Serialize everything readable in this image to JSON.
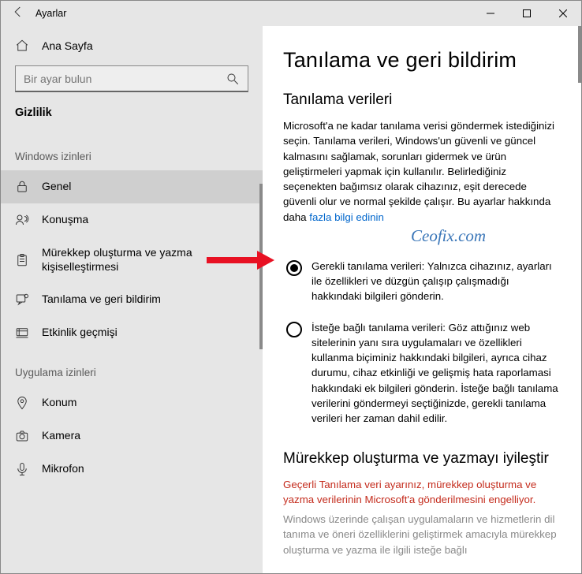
{
  "titlebar": {
    "title": "Ayarlar"
  },
  "sidebar": {
    "home_label": "Ana Sayfa",
    "search_placeholder": "Bir ayar bulun",
    "category": "Gizlilik",
    "section1": "Windows izinleri",
    "section2": "Uygulama izinleri",
    "items": [
      {
        "label": "Genel"
      },
      {
        "label": "Konuşma"
      },
      {
        "label": "Mürekkep oluşturma ve yazma kişiselleştirmesi"
      },
      {
        "label": "Tanılama ve geri bildirim"
      },
      {
        "label": "Etkinlik geçmişi"
      }
    ],
    "app_items": [
      {
        "label": "Konum"
      },
      {
        "label": "Kamera"
      },
      {
        "label": "Mikrofon"
      }
    ]
  },
  "main": {
    "title": "Tanılama ve geri bildirim",
    "section1_title": "Tanılama verileri",
    "section1_desc": "Microsoft'a ne kadar tanılama verisi göndermek istediğinizi seçin. Tanılama verileri, Windows'un güvenli ve güncel kalmasını sağlamak, sorunları gidermek ve ürün geliştirmeleri yapmak için kullanılır. Belirlediğiniz seçenekten bağımsız olarak cihazınız, eşit derecede güvenli olur ve normal şekilde çalışır. Bu ayarlar hakkında daha ",
    "section1_link": "fazla bilgi edinin",
    "watermark": "Ceofix.com",
    "radio1": "Gerekli tanılama verileri: Yalnızca cihazınız, ayarları ile özellikleri ve düzgün çalışıp çalışmadığı hakkındaki bilgileri gönderin.",
    "radio2": "İsteğe bağlı tanılama verileri: Göz attığınız web sitelerinin yanı sıra uygulamaları ve özellikleri kullanma biçiminiz hakkındaki bilgileri, ayrıca cihaz durumu, cihaz etkinliği ve gelişmiş hata raporlamasi hakkındaki ek bilgileri gönderin. İsteğe bağlı tanılama verilerini göndermeyi seçtiğinizde, gerekli tanılama verileri her zaman dahil edilir.",
    "section2_title": "Mürekkep oluşturma ve yazmayı iyileştir",
    "warn": "Geçerli Tanılama veri ayarınız, mürekkep oluşturma ve yazma verilerinin Microsoft'a gönderilmesini engelliyor.",
    "muted": "Windows üzerinde çalışan uygulamaların ve hizmetlerin dil tanıma ve öneri özelliklerini geliştirmek amacıyla mürekkep oluşturma ve yazma ile ilgili isteğe bağlı"
  }
}
